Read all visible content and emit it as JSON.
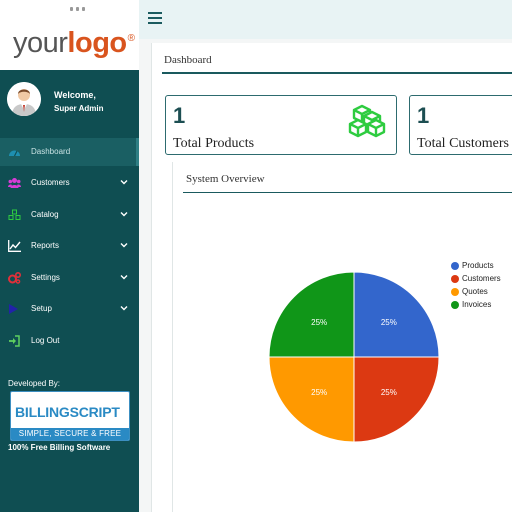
{
  "brand": {
    "logo_part1": "your",
    "logo_part2": "logo",
    "logo_reg": "®"
  },
  "user": {
    "welcome": "Welcome,",
    "role": "Super Admin"
  },
  "sidebar": {
    "items": [
      {
        "label": "Dashboard",
        "icon": "dashboard-icon",
        "active": true,
        "chevron": false
      },
      {
        "label": "Customers",
        "icon": "users-icon",
        "active": false,
        "chevron": true
      },
      {
        "label": "Catalog",
        "icon": "cubes-icon",
        "active": false,
        "chevron": true
      },
      {
        "label": "Reports",
        "icon": "line-chart-icon",
        "active": false,
        "chevron": true
      },
      {
        "label": "Settings",
        "icon": "gears-icon",
        "active": false,
        "chevron": true
      },
      {
        "label": "Setup",
        "icon": "play-icon",
        "active": false,
        "chevron": true
      },
      {
        "label": "Log Out",
        "icon": "sign-out-icon",
        "active": false,
        "chevron": false
      }
    ],
    "developed_by": "Developed By:",
    "billing_title": "BILLINGSCRIPT",
    "billing_tagline": "SIMPLE, SECURE & FREE",
    "free_text": "100% Free Billing Software"
  },
  "main": {
    "title": "Dashboard",
    "cards": [
      {
        "value": "1",
        "label": "Total Products",
        "icon": "cubes-icon"
      },
      {
        "value": "1",
        "label": "Total Customers",
        "icon": ""
      }
    ],
    "overview_title": "System Overview"
  },
  "colors": {
    "sidebar": "#0f4e52",
    "accent": "#1a5a5e",
    "products": "#3366cc",
    "customers": "#dc3912",
    "quotes": "#ff9900",
    "invoices": "#109618"
  },
  "chart_data": {
    "type": "pie",
    "categories": [
      "Products",
      "Customers",
      "Quotes",
      "Invoices"
    ],
    "values": [
      1,
      1,
      1,
      1
    ],
    "labels": [
      "25%",
      "25%",
      "25%",
      "25%"
    ],
    "colors": [
      "#3366cc",
      "#dc3912",
      "#ff9900",
      "#109618"
    ],
    "legend": "right"
  }
}
